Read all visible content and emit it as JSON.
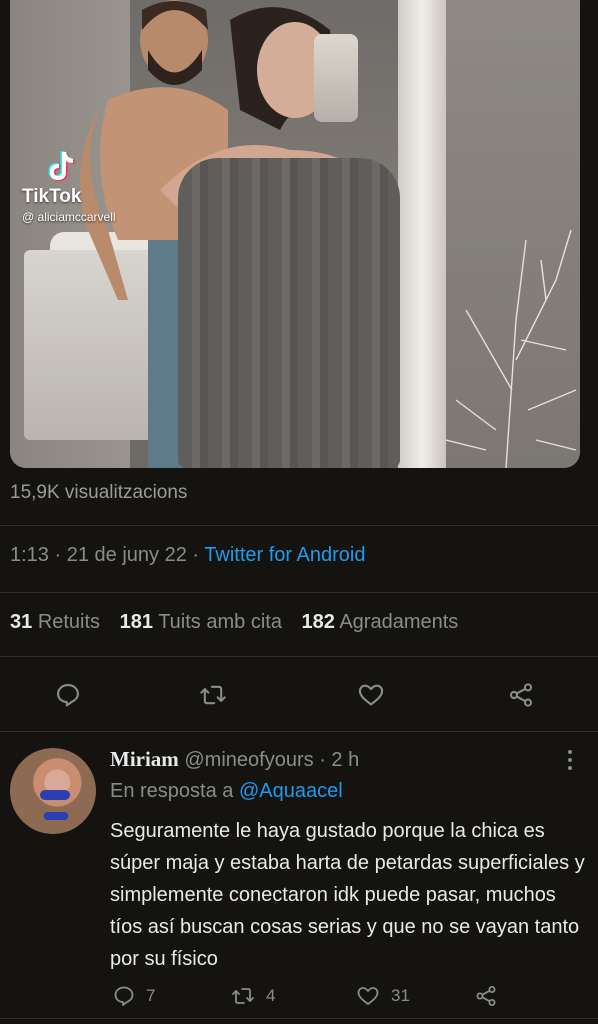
{
  "media": {
    "watermark_brand": "TikTok",
    "watermark_handle": "@ aliciamccarvell"
  },
  "tweet": {
    "views": "15,9K visualitzacions",
    "time": "1:13",
    "separator": "·",
    "date": "21 de juny 22",
    "client": "Twitter for Android",
    "stats": {
      "retweets_count": "31",
      "retweets_label": "Retuits",
      "quotes_count": "181",
      "quotes_label": "Tuits amb cita",
      "likes_count": "182",
      "likes_label": "Agradaments"
    },
    "actions": [
      "reply-icon",
      "retweet-icon",
      "like-icon",
      "share-icon"
    ]
  },
  "reply": {
    "name": "Miriam",
    "handle": "@mineofyours",
    "time": "· 2 h",
    "in_reply_prefix": "En resposta a",
    "in_reply_mention": "@Aquaacel",
    "text": "Seguramente le haya gustado porque la chica es súper maja y estaba harta de petardas superficiales y simplemente conectaron idk puede pasar, muchos tíos así buscan cosas serias y que no se vayan tanto por su físico",
    "replies": "7",
    "retweets": "4",
    "likes": "31"
  },
  "colors": {
    "background": "#15130f",
    "accent": "#1d9bf0",
    "muted": "#8a8c8c",
    "text": "#e7e9ea"
  }
}
